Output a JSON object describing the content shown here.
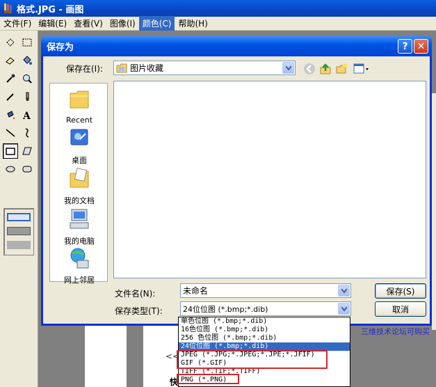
{
  "window": {
    "title": "格式.JPG - 画图"
  },
  "menubar": [
    "文件(F)",
    "编辑(E)",
    "查看(V)",
    "图像(I)",
    "颜色(C)",
    "帮助(H)"
  ],
  "menubar_active_index": 4,
  "background": {
    "right_text": "三维技术论坛可购买",
    "left_text": "<<",
    "bottom_text": "快"
  },
  "dialog": {
    "title": "保存为",
    "save_in_label": "保存在(I):",
    "save_in_value": "图片收藏",
    "places": [
      "Recent",
      "桌面",
      "我的文档",
      "我的电脑",
      "网上邻居"
    ],
    "filename_label": "文件名(N):",
    "filename_value": "未命名",
    "filetype_label": "保存类型(T):",
    "filetype_value": "24位位图 (*.bmp;*.dib)",
    "save_button": "保存(S)",
    "cancel_button": "取消",
    "help_button": "?",
    "close_button": "✕"
  },
  "filetype_options": [
    "单色位图 (*.bmp;*.dib)",
    "16色位图 (*.bmp;*.dib)",
    "256 色位图 (*.bmp;*.dib)",
    "24位位图 (*.bmp;*.dib)",
    "JPEG (*.JPG;*.JPEG;*.JPE;*.JFIF)",
    "GIF (*.GIF)",
    "TIFF (*.TIF;*.TIFF)",
    "PNG (*.PNG)"
  ],
  "filetype_selected_index": 3,
  "colors": {
    "accent": "#316ac5",
    "annotation": "#d6242c",
    "title_blue": "#0055e5"
  }
}
